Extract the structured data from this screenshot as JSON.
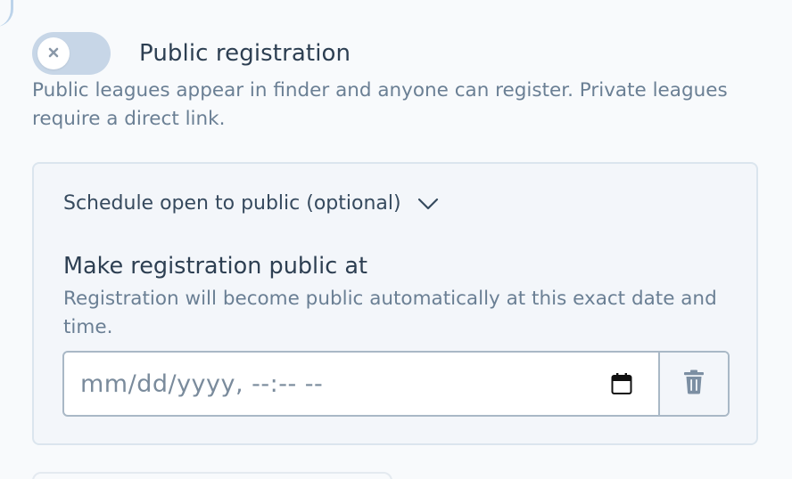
{
  "registration": {
    "toggle_title": "Public registration",
    "toggle_state": "off",
    "help_text": "Public leagues appear in finder and anyone can register. Private leagues require a direct link."
  },
  "schedule": {
    "collapse_label": "Schedule open to public (optional)",
    "field_title": "Make registration public at",
    "field_help": "Registration will become public automatically at this exact date and time.",
    "date_placeholder": "mm/dd/yyyy, --:-- --"
  },
  "icons": {
    "toggle_knob": "close-icon",
    "collapse": "chevron-down-icon",
    "calendar": "calendar-icon",
    "delete": "trash-icon"
  },
  "colors": {
    "toggle_track_off": "#c7d6e7",
    "heading_text": "#2d3f52",
    "muted_text": "#6a7f94",
    "card_background": "#f3f6fa",
    "input_border": "#a9b8c6",
    "delete_icon": "#7c8fa3"
  }
}
